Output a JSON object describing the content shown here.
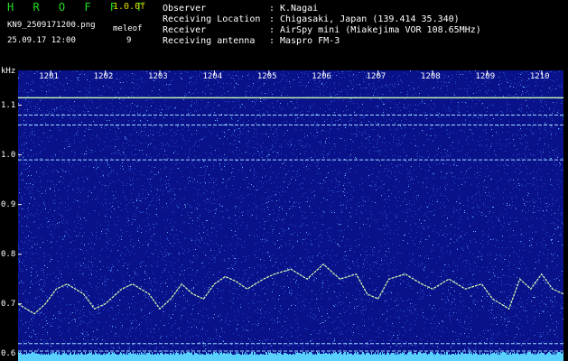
{
  "header": {
    "app_title": "H R O F F T",
    "version": "1.0.0f",
    "filename": "KN9_2509171200.png",
    "param_label": "meleof",
    "datetime": "25.09.17 12:00",
    "param_value": "9"
  },
  "observation": [
    {
      "key": "Observer",
      "value": "K.Nagai"
    },
    {
      "key": "Receiving Location",
      "value": "Chigasaki, Japan (139.414 35.340)"
    },
    {
      "key": "Receiver",
      "value": "AirSpy mini (Miakejima VOR 108.65MHz)"
    },
    {
      "key": "Receiving antenna",
      "value": "Maspro FM-3"
    }
  ],
  "colors": {
    "background": "#0a128a",
    "noise": "#3c78ff",
    "trace": "#d8ffb0",
    "header_green": "#22dd22",
    "header_yellow": "#dddd00",
    "text": "#ffffff"
  },
  "chart_data": {
    "type": "heatmap",
    "ylabel": "kHz",
    "y_ticks": [
      "1.1",
      "1.0",
      "0.9",
      "0.8",
      "0.7",
      "0.6"
    ],
    "ylim": [
      0.585,
      1.17
    ],
    "x_ticks": [
      "1201",
      "1202",
      "1203",
      "1204",
      "1205",
      "1206",
      "1207",
      "1208",
      "1209",
      "1210"
    ],
    "xlim": [
      1200.4,
      1210.4
    ],
    "horizontal_lines_khz": [
      1.115,
      1.08,
      1.06,
      0.99,
      0.62,
      0.605
    ],
    "trace": {
      "x": [
        1200.4,
        1200.7,
        1200.9,
        1201.1,
        1201.3,
        1201.6,
        1201.8,
        1202.0,
        1202.3,
        1202.5,
        1202.8,
        1203.0,
        1203.2,
        1203.4,
        1203.6,
        1203.8,
        1204.0,
        1204.2,
        1204.4,
        1204.6,
        1204.9,
        1205.1,
        1205.4,
        1205.7,
        1206.0,
        1206.3,
        1206.6,
        1206.8,
        1207.0,
        1207.2,
        1207.5,
        1207.8,
        1208.0,
        1208.3,
        1208.6,
        1208.9,
        1209.1,
        1209.4,
        1209.6,
        1209.8,
        1210.0,
        1210.2,
        1210.4
      ],
      "y": [
        0.7,
        0.68,
        0.7,
        0.73,
        0.74,
        0.72,
        0.69,
        0.7,
        0.73,
        0.74,
        0.72,
        0.69,
        0.71,
        0.74,
        0.72,
        0.71,
        0.74,
        0.755,
        0.745,
        0.73,
        0.75,
        0.76,
        0.77,
        0.75,
        0.78,
        0.75,
        0.76,
        0.72,
        0.71,
        0.75,
        0.76,
        0.74,
        0.73,
        0.75,
        0.73,
        0.74,
        0.71,
        0.69,
        0.75,
        0.73,
        0.76,
        0.73,
        0.72
      ]
    }
  }
}
